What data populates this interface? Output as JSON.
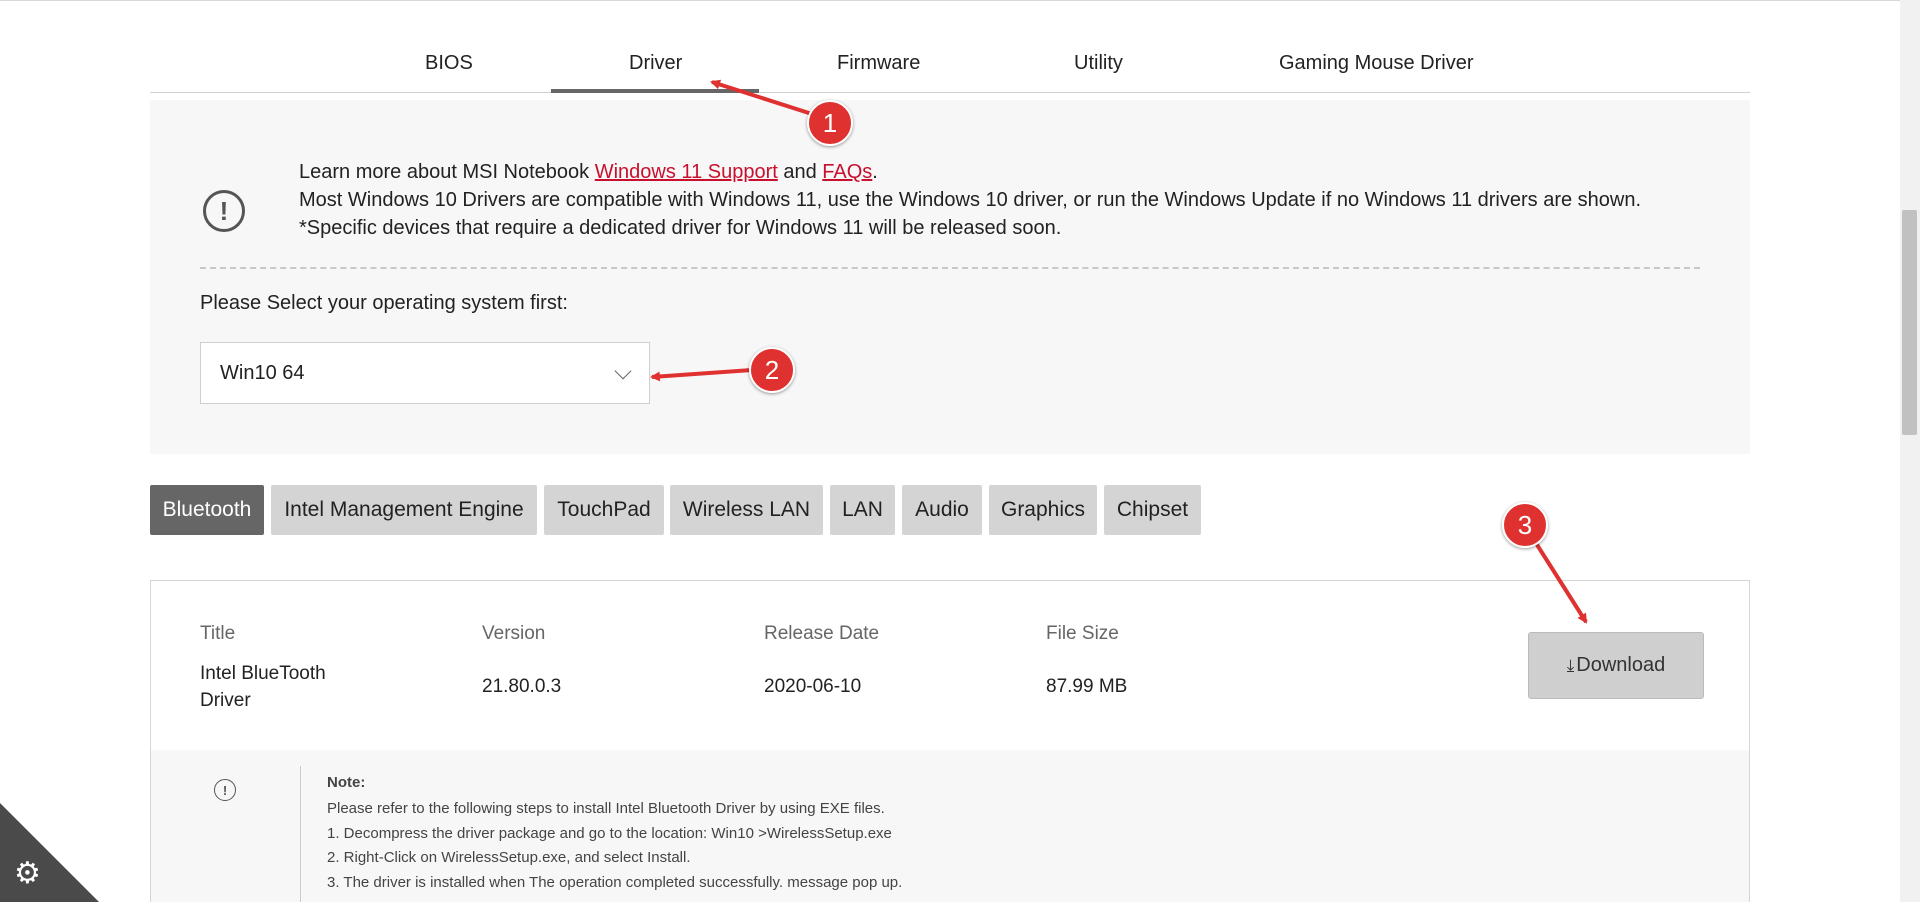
{
  "tabs": [
    {
      "label": "BIOS"
    },
    {
      "label": "Driver"
    },
    {
      "label": "Firmware"
    },
    {
      "label": "Utility"
    },
    {
      "label": "Gaming Mouse Driver"
    }
  ],
  "info": {
    "line1_prefix": "Learn more about MSI Notebook ",
    "link1": "Windows 11 Support",
    "line1_mid": " and ",
    "link2": "FAQs",
    "line1_suffix": ".",
    "line2": "Most Windows 10 Drivers are compatible with Windows 11, use the Windows 10 driver, or run the Windows Update if no Windows 11 drivers are shown.",
    "line3": "*Specific devices that require a dedicated driver for Windows 11 will be released soon.",
    "icon": "exclamation-circle-icon"
  },
  "os_selector": {
    "label": "Please Select your operating system first:",
    "selected": "Win10 64"
  },
  "categories": [
    {
      "label": "Bluetooth"
    },
    {
      "label": "Intel Management Engine"
    },
    {
      "label": "TouchPad"
    },
    {
      "label": "Wireless LAN"
    },
    {
      "label": "LAN"
    },
    {
      "label": "Audio"
    },
    {
      "label": "Graphics"
    },
    {
      "label": "Chipset"
    }
  ],
  "driver": {
    "headers": {
      "title": "Title",
      "version": "Version",
      "release_date": "Release Date",
      "file_size": "File Size"
    },
    "title": "Intel BlueTooth Driver",
    "version": "21.80.0.3",
    "release_date": "2020-06-10",
    "file_size": "87.99 MB",
    "download_label": "Download",
    "download_icon": "⤓"
  },
  "note": {
    "title": "Note:",
    "lines": [
      "Please refer to the following steps to install Intel Bluetooth Driver by using EXE files.",
      "1. Decompress the driver package and go to the location: Win10 >WirelessSetup.exe",
      "2. Right-Click on WirelessSetup.exe, and select Install.",
      "3. The driver is installed when The operation completed successfully. message pop up."
    ]
  },
  "annotations": [
    {
      "label": "1"
    },
    {
      "label": "2"
    },
    {
      "label": "3"
    }
  ],
  "colors": {
    "accent_red": "#c8102e",
    "badge_red": "#e03131",
    "active_tab": "#666666"
  },
  "corner": {
    "icon": "⚙",
    "icon_name": "gear-icon"
  }
}
